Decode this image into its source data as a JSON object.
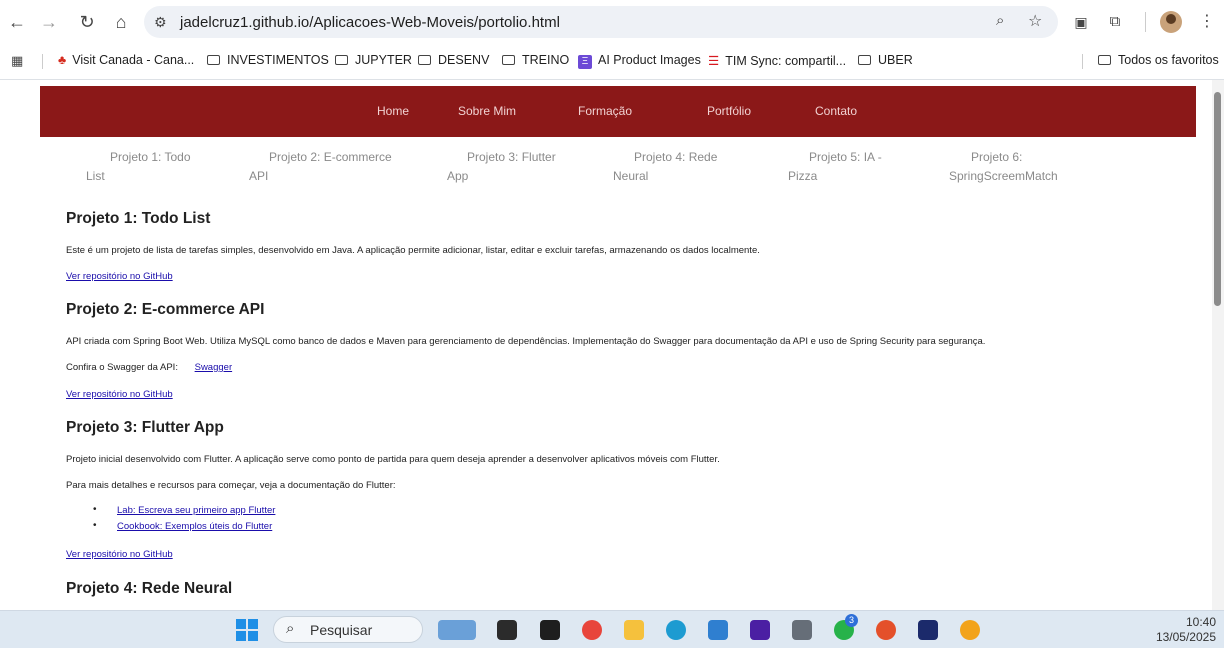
{
  "browser": {
    "url": "jadelcruz1.github.io/Aplicacoes-Web-Moveis/portolio.html",
    "bookmarks": [
      {
        "label": "Visit Canada - Cana...",
        "icon": "maple-leaf-icon"
      },
      {
        "label": "INVESTIMENTOS",
        "icon": "folder-icon"
      },
      {
        "label": "JUPYTER",
        "icon": "folder-icon"
      },
      {
        "label": "DESENV",
        "icon": "folder-icon"
      },
      {
        "label": "TREINO",
        "icon": "folder-icon"
      },
      {
        "label": "AI Product Images",
        "icon": "ai-icon"
      },
      {
        "label": "TIM Sync: compartil...",
        "icon": "tim-icon"
      },
      {
        "label": "UBER",
        "icon": "folder-icon"
      }
    ],
    "all_bookmarks": "Todos os favoritos"
  },
  "site": {
    "nav": [
      "Home",
      "Sobre Mim",
      "Formação",
      "Portfólio",
      "Contato"
    ],
    "subnav": [
      {
        "l1": "Projeto 1: Todo",
        "l2": "List"
      },
      {
        "l1": "Projeto 2: E-commerce",
        "l2": "API"
      },
      {
        "l1": "Projeto 3: Flutter",
        "l2": "App"
      },
      {
        "l1": "Projeto 4: Rede",
        "l2": "Neural"
      },
      {
        "l1": "Projeto 5: IA -",
        "l2": "Pizza"
      },
      {
        "l1": "Projeto 6:",
        "l2": "SpringScreemMatch"
      }
    ]
  },
  "projects": {
    "p1": {
      "title": "Projeto 1: Todo List",
      "desc": "Este é um projeto de lista de tarefas simples, desenvolvido em Java. A aplicação permite adicionar, listar, editar e excluir tarefas, armazenando os dados localmente.",
      "repo": "Ver repositório no GitHub"
    },
    "p2": {
      "title": "Projeto 2: E-commerce API",
      "desc": "API criada com Spring Boot Web. Utiliza MySQL como banco de dados e Maven para gerenciamento de dependências. Implementação do Swagger para documentação da API e uso de Spring Security para segurança.",
      "swagger_label": "Confira o Swagger da API:",
      "swagger_link": "Swagger",
      "repo": "Ver repositório no GitHub"
    },
    "p3": {
      "title": "Projeto 3: Flutter App",
      "desc": "Projeto inicial desenvolvido com Flutter. A aplicação serve como ponto de partida para quem deseja aprender a desenvolver aplicativos móveis com Flutter.",
      "docs": "Para mais detalhes e recursos para começar, veja a documentação do Flutter:",
      "links": [
        "Lab: Escreva seu primeiro app Flutter",
        "Cookbook: Exemplos úteis do Flutter"
      ],
      "repo": "Ver repositório no GitHub"
    },
    "p4": {
      "title": "Projeto 4: Rede Neural"
    }
  },
  "taskbar": {
    "search": "Pesquisar",
    "time": "10:40",
    "date": "13/05/2025",
    "whatsapp_badge": "3"
  }
}
